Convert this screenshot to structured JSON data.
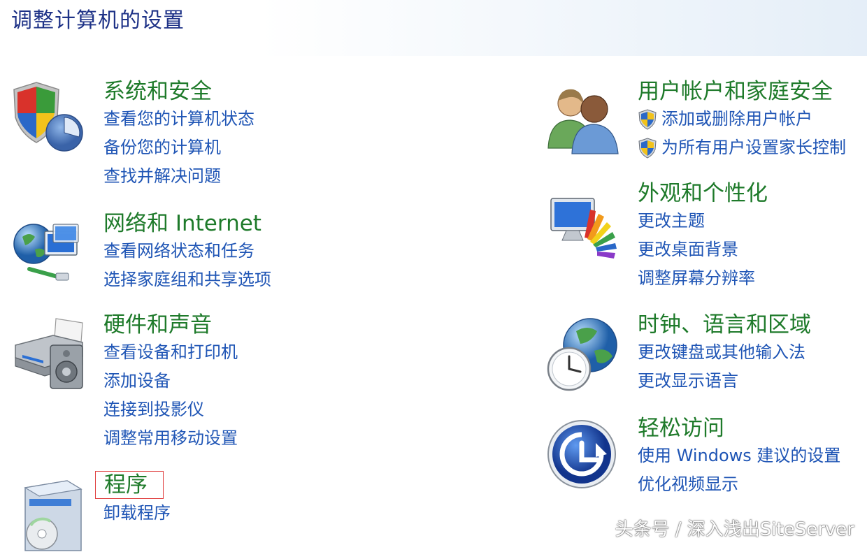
{
  "page_title": "调整计算机的设置",
  "left": [
    {
      "title": "系统和安全",
      "icon": "shield-chart-icon",
      "links": [
        "查看您的计算机状态",
        "备份您的计算机",
        "查找并解决问题"
      ]
    },
    {
      "title": "网络和 Internet",
      "icon": "network-globe-icon",
      "links": [
        "查看网络状态和任务",
        "选择家庭组和共享选项"
      ]
    },
    {
      "title": "硬件和声音",
      "icon": "printer-speaker-icon",
      "links": [
        "查看设备和打印机",
        "添加设备",
        "连接到投影仪",
        "调整常用移动设置"
      ]
    },
    {
      "title": "程序",
      "icon": "programs-disc-icon",
      "links": [
        "卸载程序"
      ]
    }
  ],
  "right": [
    {
      "title": "用户帐户和家庭安全",
      "icon": "users-icon",
      "links": [
        "添加或删除用户帐户",
        "为所有用户设置家长控制"
      ]
    },
    {
      "title": "外观和个性化",
      "icon": "monitor-palette-icon",
      "links": [
        "更改主题",
        "更改桌面背景",
        "调整屏幕分辨率"
      ]
    },
    {
      "title": "时钟、语言和区域",
      "icon": "clock-globe-icon",
      "links": [
        "更改键盘或其他输入法",
        "更改显示语言"
      ]
    },
    {
      "title": "轻松访问",
      "icon": "ease-of-access-icon",
      "links": [
        "使用 Windows 建议的设置",
        "优化视频显示"
      ]
    }
  ],
  "watermark": "头条号 / 深入浅出SiteServer",
  "colors": {
    "title_green": "#1e7a2a",
    "link_blue": "#1f55b5",
    "header_navy": "#1e3287",
    "highlight_red": "#e04040"
  }
}
